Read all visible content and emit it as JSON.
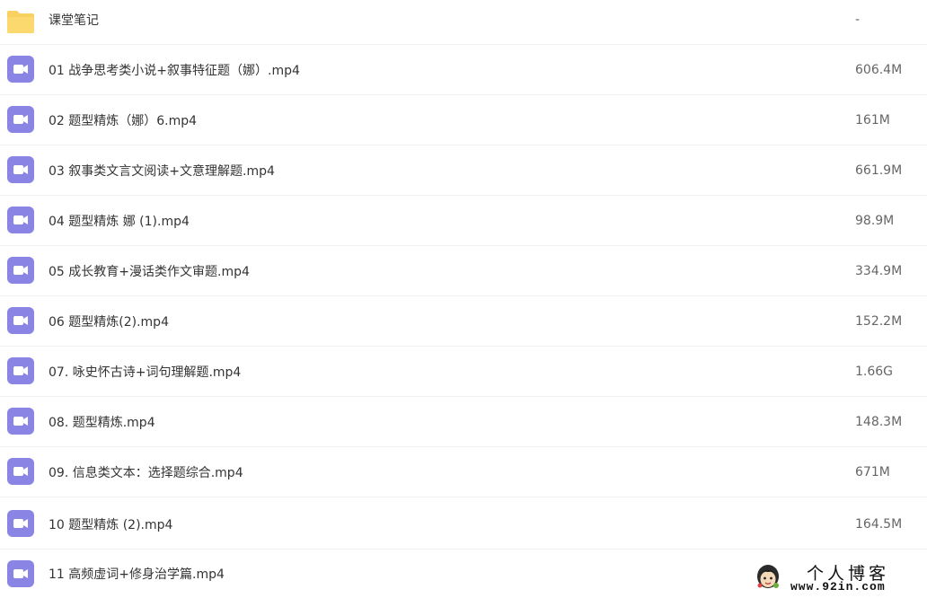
{
  "colors": {
    "video_icon_bg": "#8a84e4",
    "folder_icon": "#f9d161",
    "divider": "#f1f2f4"
  },
  "folder": {
    "name": "课堂笔记",
    "size": "-",
    "icon": "folder-icon"
  },
  "files": [
    {
      "name": "01 战争思考类小说+叙事特征题（娜）.mp4",
      "size": "606.4M",
      "icon": "video-file-icon"
    },
    {
      "name": "02 题型精炼（娜）6.mp4",
      "size": "161M",
      "icon": "video-file-icon"
    },
    {
      "name": "03 叙事类文言文阅读+文意理解题.mp4",
      "size": "661.9M",
      "icon": "video-file-icon"
    },
    {
      "name": "04 题型精炼 娜 (1).mp4",
      "size": "98.9M",
      "icon": "video-file-icon"
    },
    {
      "name": "05 成长教育+漫话类作文审题.mp4",
      "size": "334.9M",
      "icon": "video-file-icon"
    },
    {
      "name": "06 题型精炼(2).mp4",
      "size": "152.2M",
      "icon": "video-file-icon"
    },
    {
      "name": "07. 咏史怀古诗+词句理解题.mp4",
      "size": "1.66G",
      "icon": "video-file-icon"
    },
    {
      "name": "08. 题型精炼.mp4",
      "size": "148.3M",
      "icon": "video-file-icon"
    },
    {
      "name": "09. 信息类文本：选择题综合.mp4",
      "size": "671M",
      "icon": "video-file-icon"
    },
    {
      "name": "10 题型精炼 (2).mp4",
      "size": "164.5M",
      "icon": "video-file-icon"
    },
    {
      "name": "11 高频虚词+修身治学篇.mp4",
      "size": "",
      "icon": "video-file-icon"
    }
  ],
  "watermark": {
    "title": "个人博客",
    "url": "www.92in.com"
  }
}
